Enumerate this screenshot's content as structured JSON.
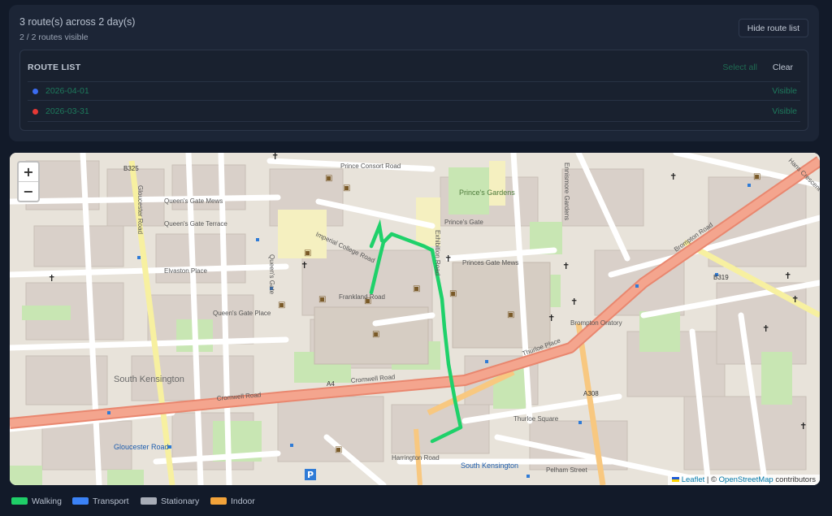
{
  "summary": {
    "title": "3 route(s) across 2 day(s)",
    "visible": "2 / 2 routes visible",
    "hide_button": "Hide route list"
  },
  "route_list": {
    "title": "ROUTE LIST",
    "select_all": "Select all",
    "clear": "Clear",
    "routes": [
      {
        "date": "2026-04-01",
        "status": "Visible",
        "color": "#3b6cf0"
      },
      {
        "date": "2026-03-31",
        "status": "Visible",
        "color": "#e53935"
      }
    ]
  },
  "map": {
    "zoom_in": "+",
    "zoom_out": "−",
    "attribution": {
      "leaflet": "Leaflet",
      "separator": " | © ",
      "osm": "OpenStreetMap",
      "suffix": " contributors"
    },
    "labels": {
      "princes_gardens": "Prince's Gardens",
      "prince_consort_road": "Prince Consort Road",
      "princes_gate": "Prince's Gate",
      "queens_gate_mews": "Queen's Gate Mews",
      "queens_gate_terrace": "Queen's Gate Terrace",
      "queens_gate_place": "Queen's Gate Place",
      "queens_gate": "Queen's Gate",
      "gloucester_road_st": "Gloucester Road",
      "gloucester_road_station": "Gloucester Road",
      "cromwell_road": "Cromwell Road",
      "cromwell_road_a4": "Cromwell Road",
      "a4": "A4",
      "south_kensington": "South Kensington",
      "south_kensington_station": "South Kensington",
      "thurloe_place": "Thurloe Place",
      "brompton_oratory": "Brompton Oratory",
      "brompton_road": "Brompton Road",
      "exhibition_road": "Exhibition Road",
      "frankland_road": "Frankland Road",
      "imperial_college_road": "Imperial College Road",
      "princes_gate_mews": "Princes Gate Mews",
      "elvaston_place": "Elvaston Place",
      "b325": "B325",
      "b319": "B319",
      "a308": "A308",
      "pelham_street": "Pelham Street",
      "thurloe_square": "Thurloe Square",
      "ennismore_gardens": "Ennismore Gardens",
      "harrington_road": "Harrington Road",
      "hans_crescent": "Hans Crescent"
    }
  },
  "legend": [
    {
      "label": "Walking",
      "color": "#1fce68"
    },
    {
      "label": "Transport",
      "color": "#3b82f6"
    },
    {
      "label": "Stationary",
      "color": "#a7acb6"
    },
    {
      "label": "Indoor",
      "color": "#f2a33a"
    }
  ]
}
